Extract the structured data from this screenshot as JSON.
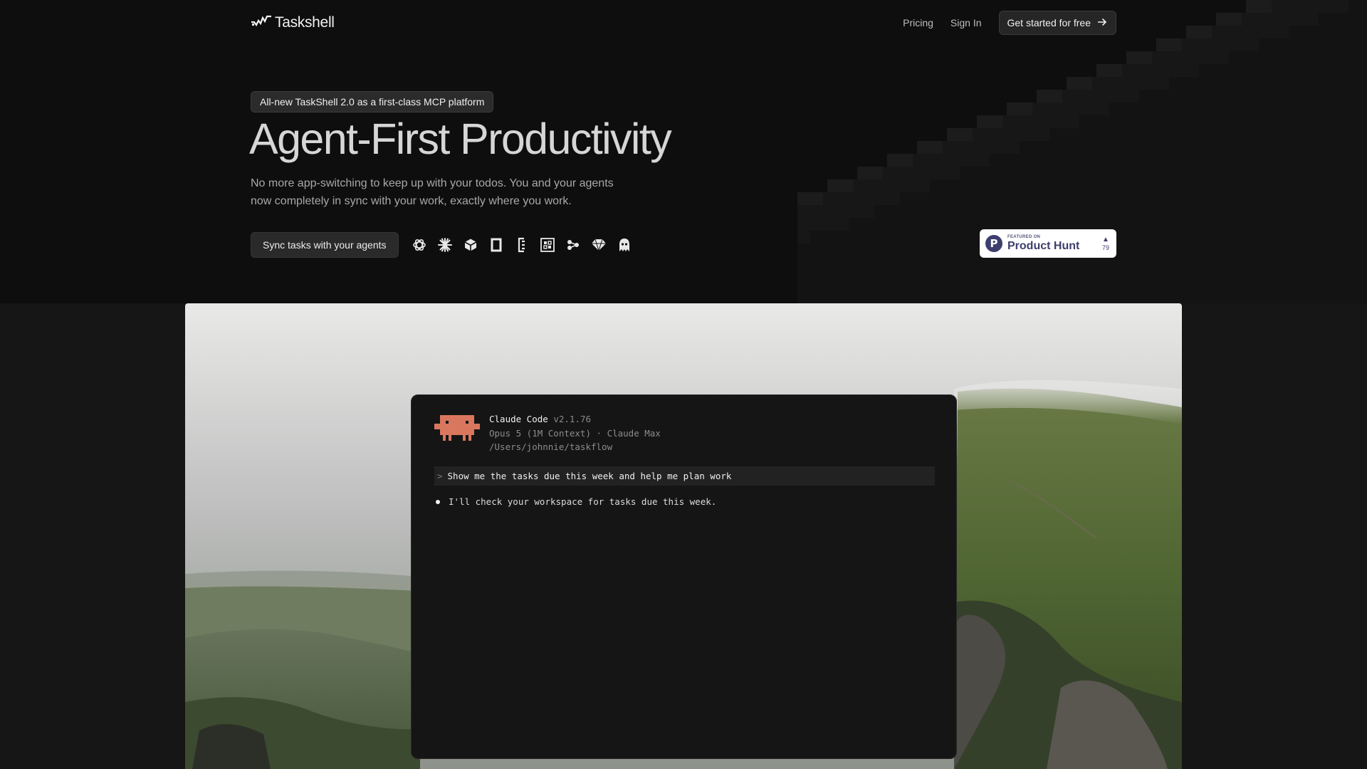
{
  "brand": {
    "name": "Taskshell",
    "logo_icon": "check-wave-icon"
  },
  "nav": {
    "links": [
      "Pricing",
      "Sign In"
    ],
    "cta_label": "Get started for free",
    "cta_icon": "arrow-right-icon"
  },
  "hero": {
    "badge": "All-new TaskShell 2.0 as a first-class MCP platform",
    "title": "Agent-First Productivity",
    "subtitle_lines": [
      "No more app-switching to keep up with your todos. You and your agents",
      "now completely in sync with your work, exactly where you work."
    ],
    "sync_button": "Sync tasks with your agents",
    "agent_icons": [
      "openai-icon",
      "claude-icon",
      "cube-icon",
      "square-icon",
      "bracket-icon",
      "grid-icon",
      "nodes-icon",
      "diamond-icon",
      "ghost-icon"
    ]
  },
  "product_hunt": {
    "featured": "FEATURED ON",
    "name": "Product Hunt",
    "votes": "79"
  },
  "terminal": {
    "app_name": "Claude Code",
    "version": "v2.1.76",
    "model_line": "Opus 5 (1M Context) · Claude Max",
    "path": "/Users/johnnie/taskflow",
    "prompt_caret": ">",
    "prompt": "Show me the tasks due this week and help me plan work",
    "reply": "I'll check your workspace for tasks due this week.",
    "mascot_color": "#d9775e"
  },
  "colors": {
    "background": "#161616",
    "hero_background": "#0e0e0e",
    "terminal_background": "#151515",
    "accent_mascot": "#d9775e"
  }
}
